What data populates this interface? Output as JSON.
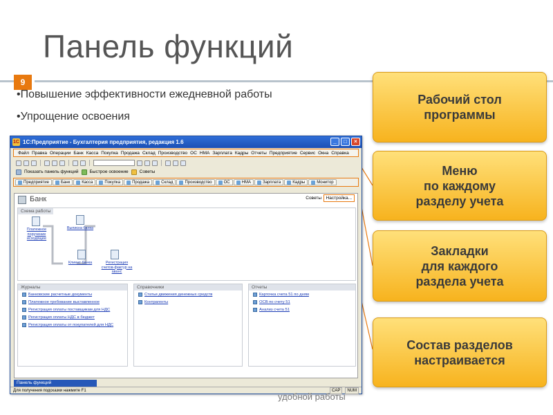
{
  "slide": {
    "title": "Панель функций",
    "number": "9",
    "bullets": [
      "•Повышение эффективности ежедневной работы",
      "•Упрощение освоения"
    ],
    "footer": "удобной работы"
  },
  "callouts": [
    "Рабочий стол\nпрограммы",
    "Меню\nпо каждому\nразделу учета",
    "Закладки\nдля каждого\nраздела учета",
    "Состав разделов\nнастраивается"
  ],
  "colors": {
    "accent": "#e8790f",
    "callout": "#f7b31e",
    "titlebar": "#1b4fb5"
  },
  "app": {
    "title": "1С:Предприятие - Бухгалтерия предприятия, редакция 1.6",
    "menu": [
      "Файл",
      "Правка",
      "Операции",
      "Банк",
      "Касса",
      "Покупка",
      "Продажа",
      "Склад",
      "Производство",
      "ОС",
      "НМА",
      "Зарплата",
      "Кадры",
      "Отчеты",
      "Предприятие",
      "Сервис",
      "Окна",
      "Справка"
    ],
    "panel_toggle": "Показать панель функций",
    "quick_start": "Быстрое освоение",
    "tips": "Советы",
    "tabs": [
      "Предприятие",
      "Банк",
      "Касса",
      "Покупка",
      "Продажа",
      "Склад",
      "Производство",
      "ОС",
      "НМА",
      "Зарплата",
      "Кадры",
      "Монитор"
    ],
    "section_title": "Банк",
    "btn_tips": "Советы",
    "btn_settings": "Настройка...",
    "scheme_label": "Схема работы",
    "scheme_docs": {
      "d1": "Платежное поручение исходящее",
      "d2": "Выписка банка",
      "d3": "Клиент банка",
      "d4": "Регистрация счетов-фактур на аванс"
    },
    "journals": {
      "title": "Журналы",
      "items": [
        "Банковские расчетные документы",
        "Платежное требование выставленное",
        "Регистрация оплаты поставщикам для НДС",
        "Регистрация оплаты НДС в бюджет",
        "Регистрация оплаты от покупателей для НДС"
      ]
    },
    "refs": {
      "title": "Справочники",
      "items": [
        "Статьи движения денежных средств",
        "Контрагенты"
      ]
    },
    "reports": {
      "title": "Отчеты",
      "items": [
        "Карточка счета 51 по дням",
        "ОСВ по счету 51",
        "Анализ счета 51"
      ]
    },
    "task_panel": "Панель функций",
    "status_hint": "Для получения подсказки нажмите F1",
    "status_cap": "CAP",
    "status_num": "NUM"
  }
}
